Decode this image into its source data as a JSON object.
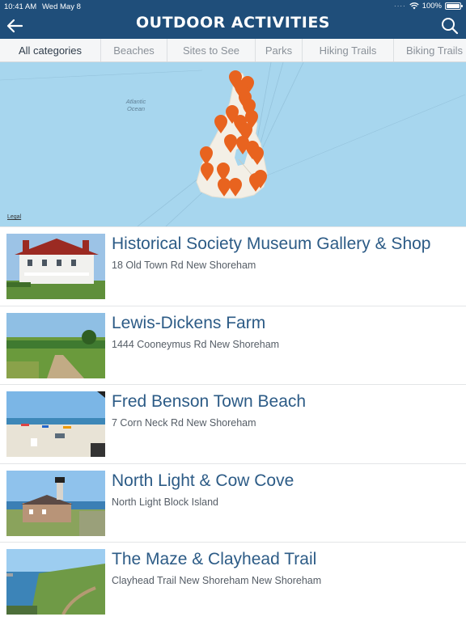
{
  "status_bar": {
    "time": "10:41 AM",
    "date": "Wed May 8",
    "battery": "100%"
  },
  "header": {
    "title": "OUTDOOR ACTIVITIES"
  },
  "tabs": [
    {
      "label": "All categories",
      "active": true
    },
    {
      "label": "Beaches",
      "active": false
    },
    {
      "label": "Sites to See",
      "active": false
    },
    {
      "label": "Parks",
      "active": false
    },
    {
      "label": "Hiking Trails",
      "active": false
    },
    {
      "label": "Biking Trails",
      "active": false
    }
  ],
  "map": {
    "ocean_label": "Atlantic Ocean",
    "legal": "Legal",
    "water_color": "#a7d6ee",
    "land_color": "#f3efe6",
    "pin_color": "#e8631f"
  },
  "places": [
    {
      "name": "Historical Society Museum Gallery & Shop",
      "address": "18 Old Town Rd New Shoreham"
    },
    {
      "name": "Lewis-Dickens Farm",
      "address": "1444 Cooneymus Rd New Shoreham"
    },
    {
      "name": "Fred Benson Town Beach",
      "address": "7 Corn Neck Rd New Shoreham"
    },
    {
      "name": "North Light & Cow Cove",
      "address": "North Light Block Island"
    },
    {
      "name": "The Maze & Clayhead Trail",
      "address": "Clayhead Trail New Shoreham New Shoreham"
    }
  ],
  "colors": {
    "header": "#1f4e7a",
    "title_link": "#2c5b86"
  }
}
